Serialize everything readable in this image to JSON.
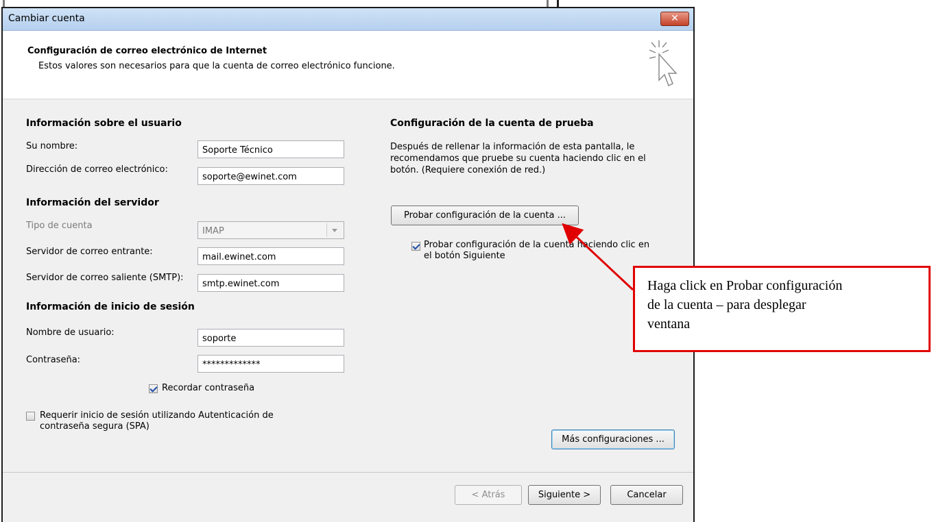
{
  "dialog": {
    "title": "Cambiar cuenta",
    "close_glyph": "✕"
  },
  "header": {
    "title": "Configuración de correo electrónico de Internet",
    "subtitle": "Estos valores son necesarios para que la cuenta de correo electrónico funcione.",
    "icon": "cursor-click-icon"
  },
  "user_info": {
    "heading": "Información sobre el usuario",
    "name_label": "Su nombre:",
    "name_value": "Soporte Técnico",
    "email_label": "Dirección de correo electrónico:",
    "email_value": "soporte@ewinet.com"
  },
  "server_info": {
    "heading": "Información del servidor",
    "account_type_label": "Tipo de cuenta",
    "account_type_value": "IMAP",
    "incoming_label": "Servidor de correo entrante:",
    "incoming_value": "mail.ewinet.com",
    "outgoing_label": "Servidor de correo saliente (SMTP):",
    "outgoing_value": "smtp.ewinet.com"
  },
  "login_info": {
    "heading": "Información de inicio de sesión",
    "username_label": "Nombre de usuario:",
    "username_value": "soporte",
    "password_label": "Contraseña:",
    "password_value": "*************",
    "remember_label": "Recordar contraseña",
    "remember_checked": true,
    "spa_label_line1": "Requerir inicio de sesión utilizando Autenticación de",
    "spa_label_line2": "contraseña segura (SPA)",
    "spa_checked": false
  },
  "test_settings": {
    "heading": "Configuración de la cuenta de prueba",
    "desc_line1": "Después de rellenar la información de esta pantalla, le",
    "desc_line2": "recomendamos que pruebe su cuenta haciendo clic en el",
    "desc_line3": "botón. (Requiere conexión de red.)",
    "test_button": "Probar configuración de la cuenta ...",
    "test_on_next_line1": "Probar configuración de la cuenta haciendo clic en",
    "test_on_next_line2": "el botón Siguiente",
    "test_on_next_checked": true,
    "more_settings_button": "Más configuraciones ..."
  },
  "footer": {
    "back": "< Atrás",
    "next": "Siguiente >",
    "cancel": "Cancelar"
  },
  "annotation": {
    "line1": "Haga click en Probar configuración",
    "line2": "de la cuenta – para desplegar",
    "line3": "ventana",
    "color": "#e00000"
  }
}
